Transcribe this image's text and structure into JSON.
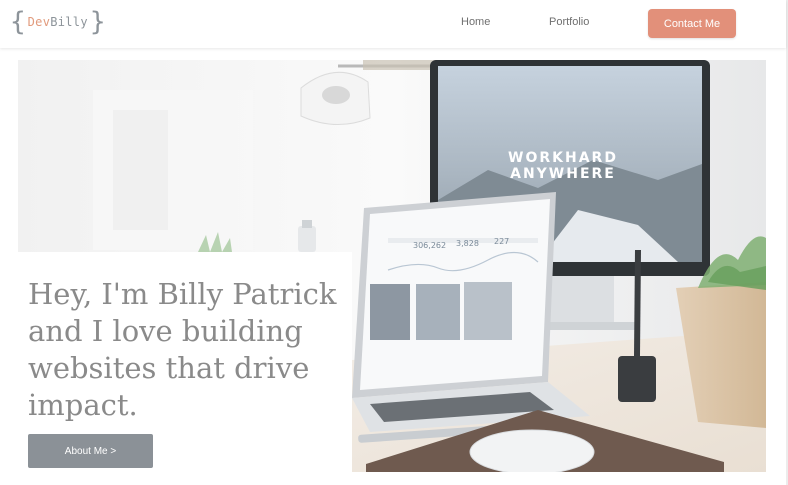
{
  "header": {
    "logo": {
      "open_brace": "{",
      "part1": "Dev",
      "part2": "Billy",
      "close_brace": "}"
    },
    "nav": [
      {
        "label": "Home"
      },
      {
        "label": "Portfolio"
      }
    ],
    "contact_label": "Contact Me"
  },
  "hero": {
    "headline": "Hey, I'm Billy Patrick and I love building websites that drive impact.",
    "about_label": "About Me >",
    "image": {
      "monitor_line1": "WORKHARD",
      "monitor_line2": "ANYWHERE",
      "stats": [
        "306,262",
        "3,828",
        "227"
      ]
    }
  },
  "colors": {
    "accent": "#e2907a",
    "logo_dev": "#e19a7c",
    "muted_gray": "#8d949a",
    "button_gray": "#8b9197",
    "headline": "#8a8a8a"
  }
}
